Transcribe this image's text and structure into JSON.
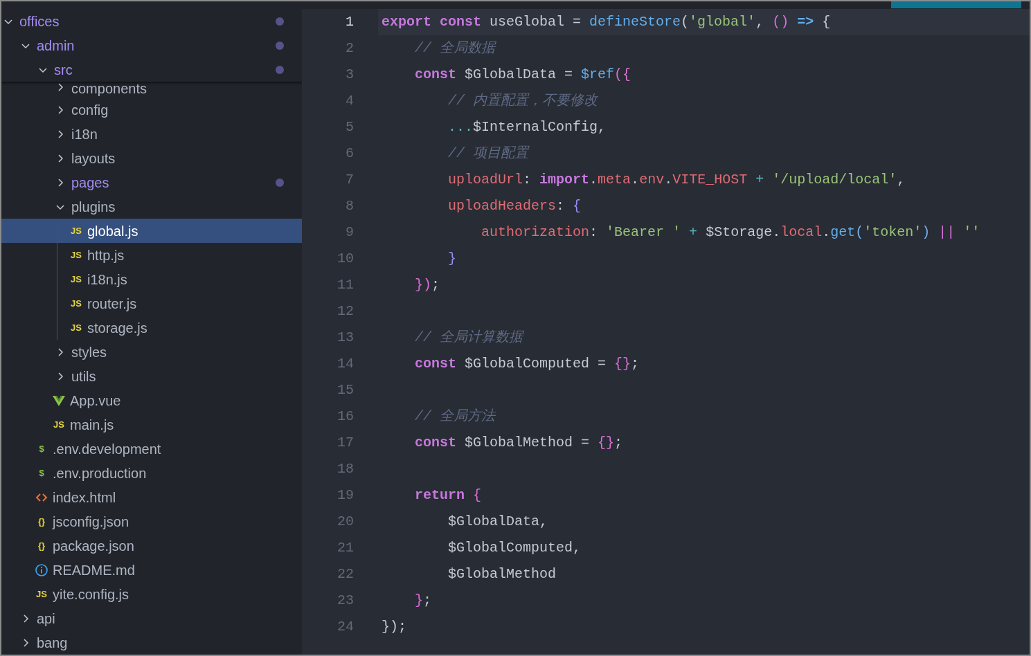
{
  "explorer": {
    "tree": [
      {
        "kind": "folder",
        "label": "offices",
        "expanded": true,
        "modified": true,
        "selected": false,
        "children": [
          {
            "kind": "folder",
            "label": "admin",
            "expanded": true,
            "modified": true,
            "selected": false,
            "children": [
              {
                "kind": "folder",
                "label": "src",
                "expanded": true,
                "modified": true,
                "selected": false,
                "children": [
                  {
                    "kind": "folder",
                    "label": "components",
                    "expanded": false,
                    "modified": false,
                    "selected": false
                  },
                  {
                    "kind": "folder",
                    "label": "config",
                    "expanded": false,
                    "modified": false,
                    "selected": false
                  },
                  {
                    "kind": "folder",
                    "label": "i18n",
                    "expanded": false,
                    "modified": false,
                    "selected": false
                  },
                  {
                    "kind": "folder",
                    "label": "layouts",
                    "expanded": false,
                    "modified": false,
                    "selected": false
                  },
                  {
                    "kind": "folder",
                    "label": "pages",
                    "expanded": false,
                    "modified": true,
                    "selected": false
                  },
                  {
                    "kind": "folder",
                    "label": "plugins",
                    "expanded": true,
                    "modified": false,
                    "selected": false,
                    "children": [
                      {
                        "kind": "js",
                        "icon": "JS",
                        "label": "global.js",
                        "modified": false,
                        "selected": true
                      },
                      {
                        "kind": "js",
                        "icon": "JS",
                        "label": "http.js",
                        "modified": false,
                        "selected": false
                      },
                      {
                        "kind": "js",
                        "icon": "JS",
                        "label": "i18n.js",
                        "modified": false,
                        "selected": false
                      },
                      {
                        "kind": "js",
                        "icon": "JS",
                        "label": "router.js",
                        "modified": false,
                        "selected": false
                      },
                      {
                        "kind": "js",
                        "icon": "JS",
                        "label": "storage.js",
                        "modified": false,
                        "selected": false
                      }
                    ]
                  },
                  {
                    "kind": "folder",
                    "label": "styles",
                    "expanded": false,
                    "modified": false,
                    "selected": false
                  },
                  {
                    "kind": "folder",
                    "label": "utils",
                    "expanded": false,
                    "modified": false,
                    "selected": false
                  },
                  {
                    "kind": "vue",
                    "label": "App.vue",
                    "modified": false,
                    "selected": false
                  },
                  {
                    "kind": "js",
                    "icon": "JS",
                    "label": "main.js",
                    "modified": false,
                    "selected": false
                  }
                ]
              },
              {
                "kind": "env",
                "icon": "$",
                "label": ".env.development",
                "modified": false,
                "selected": false
              },
              {
                "kind": "env",
                "icon": "$",
                "label": ".env.production",
                "modified": false,
                "selected": false
              },
              {
                "kind": "html",
                "label": "index.html",
                "modified": false,
                "selected": false
              },
              {
                "kind": "json",
                "icon": "{}",
                "label": "jsconfig.json",
                "modified": false,
                "selected": false
              },
              {
                "kind": "json",
                "icon": "{}",
                "label": "package.json",
                "modified": false,
                "selected": false
              },
              {
                "kind": "info",
                "label": "README.md",
                "modified": false,
                "selected": false
              },
              {
                "kind": "js",
                "icon": "JS",
                "label": "yite.config.js",
                "modified": false,
                "selected": false
              }
            ]
          },
          {
            "kind": "folder",
            "label": "api",
            "expanded": false,
            "modified": false,
            "selected": false
          },
          {
            "kind": "folder",
            "label": "bang",
            "expanded": false,
            "modified": false,
            "selected": false
          }
        ]
      }
    ]
  },
  "editor": {
    "lines": [
      {
        "number": "1",
        "current": true,
        "tokens": [
          {
            "kind": "keyword",
            "text": "export"
          },
          {
            "kind": "keyword",
            "text": " const"
          },
          {
            "kind": "text",
            "text": " useGlobal = "
          },
          {
            "kind": "func",
            "text": "defineStore"
          },
          {
            "kind": "text",
            "text": "("
          },
          {
            "kind": "string",
            "text": "'global'"
          },
          {
            "kind": "text",
            "text": ", "
          },
          {
            "kind": "bracket1",
            "text": "()"
          },
          {
            "kind": "arrow",
            "text": " =>"
          },
          {
            "kind": "text",
            "text": " {"
          }
        ]
      },
      {
        "number": "2",
        "current": false,
        "tokens": [
          {
            "kind": "comment",
            "text": "    // 全局数据"
          }
        ]
      },
      {
        "number": "3",
        "current": false,
        "tokens": [
          {
            "kind": "keyword",
            "text": "    const"
          },
          {
            "kind": "text",
            "text": " $GlobalData = "
          },
          {
            "kind": "func",
            "text": "$ref"
          },
          {
            "kind": "bracket1",
            "text": "({"
          }
        ]
      },
      {
        "number": "4",
        "current": false,
        "tokens": [
          {
            "kind": "comment",
            "text": "        // 内置配置，不要修改"
          }
        ]
      },
      {
        "number": "5",
        "current": false,
        "tokens": [
          {
            "kind": "op",
            "text": "        ..."
          },
          {
            "kind": "text",
            "text": "$InternalConfig,"
          }
        ]
      },
      {
        "number": "6",
        "current": false,
        "tokens": [
          {
            "kind": "comment",
            "text": "        // 项目配置"
          }
        ]
      },
      {
        "number": "7",
        "current": false,
        "tokens": [
          {
            "kind": "prop",
            "text": "        uploadUrl"
          },
          {
            "kind": "text",
            "text": ": "
          },
          {
            "kind": "keyword",
            "text": "import"
          },
          {
            "kind": "text",
            "text": "."
          },
          {
            "kind": "prop",
            "text": "meta"
          },
          {
            "kind": "text",
            "text": "."
          },
          {
            "kind": "prop",
            "text": "env"
          },
          {
            "kind": "text",
            "text": "."
          },
          {
            "kind": "prop",
            "text": "VITE_HOST"
          },
          {
            "kind": "op",
            "text": " +"
          },
          {
            "kind": "string",
            "text": " '/upload/local'"
          },
          {
            "kind": "text",
            "text": ","
          }
        ]
      },
      {
        "number": "8",
        "current": false,
        "tokens": [
          {
            "kind": "prop",
            "text": "        uploadHeaders"
          },
          {
            "kind": "text",
            "text": ": "
          },
          {
            "kind": "bracket2",
            "text": "{"
          }
        ]
      },
      {
        "number": "9",
        "current": false,
        "tokens": [
          {
            "kind": "prop",
            "text": "            authorization"
          },
          {
            "kind": "text",
            "text": ": "
          },
          {
            "kind": "string",
            "text": "'Bearer '"
          },
          {
            "kind": "op",
            "text": " +"
          },
          {
            "kind": "text",
            "text": " $Storage."
          },
          {
            "kind": "prop",
            "text": "local"
          },
          {
            "kind": "text",
            "text": "."
          },
          {
            "kind": "func",
            "text": "get"
          },
          {
            "kind": "bracket3",
            "text": "("
          },
          {
            "kind": "string",
            "text": "'token'"
          },
          {
            "kind": "bracket3",
            "text": ")"
          },
          {
            "kind": "bracket1",
            "text": " ||"
          },
          {
            "kind": "string",
            "text": " ''"
          }
        ]
      },
      {
        "number": "10",
        "current": false,
        "tokens": [
          {
            "kind": "bracket2",
            "text": "        }"
          }
        ]
      },
      {
        "number": "11",
        "current": false,
        "tokens": [
          {
            "kind": "bracket1",
            "text": "    })"
          },
          {
            "kind": "text",
            "text": ";"
          }
        ]
      },
      {
        "number": "12",
        "current": false
      },
      {
        "number": "13",
        "current": false,
        "tokens": [
          {
            "kind": "comment",
            "text": "    // 全局计算数据"
          }
        ]
      },
      {
        "number": "14",
        "current": false,
        "tokens": [
          {
            "kind": "keyword",
            "text": "    const"
          },
          {
            "kind": "text",
            "text": " $GlobalComputed = "
          },
          {
            "kind": "bracket1",
            "text": "{}"
          },
          {
            "kind": "text",
            "text": ";"
          }
        ]
      },
      {
        "number": "15",
        "current": false
      },
      {
        "number": "16",
        "current": false,
        "tokens": [
          {
            "kind": "comment",
            "text": "    // 全局方法"
          }
        ]
      },
      {
        "number": "17",
        "current": false,
        "tokens": [
          {
            "kind": "keyword",
            "text": "    const"
          },
          {
            "kind": "text",
            "text": " $GlobalMethod = "
          },
          {
            "kind": "bracket1",
            "text": "{}"
          },
          {
            "kind": "text",
            "text": ";"
          }
        ]
      },
      {
        "number": "18",
        "current": false
      },
      {
        "number": "19",
        "current": false,
        "tokens": [
          {
            "kind": "keyword",
            "text": "    return"
          },
          {
            "kind": "bracket1",
            "text": " {"
          }
        ]
      },
      {
        "number": "20",
        "current": false,
        "tokens": [
          {
            "kind": "text",
            "text": "        $GlobalData,"
          }
        ]
      },
      {
        "number": "21",
        "current": false,
        "tokens": [
          {
            "kind": "text",
            "text": "        $GlobalComputed,"
          }
        ]
      },
      {
        "number": "22",
        "current": false,
        "tokens": [
          {
            "kind": "text",
            "text": "        $GlobalMethod"
          }
        ]
      },
      {
        "number": "23",
        "current": false,
        "tokens": [
          {
            "kind": "bracket1",
            "text": "    }"
          },
          {
            "kind": "text",
            "text": ";"
          }
        ]
      },
      {
        "number": "24",
        "current": false,
        "tokens": [
          {
            "kind": "text",
            "text": "});"
          }
        ]
      }
    ]
  }
}
